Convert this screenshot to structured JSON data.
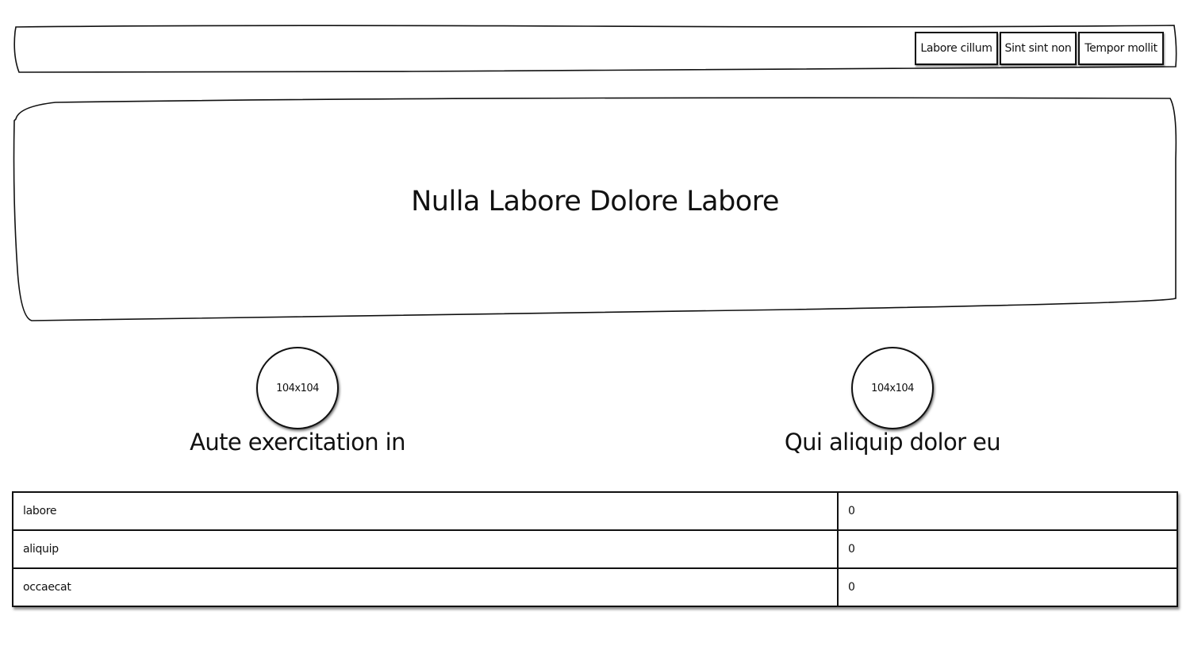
{
  "nav": {
    "links": [
      {
        "label": "Labore cillum"
      },
      {
        "label": "Sint sint non"
      },
      {
        "label": "Tempor mollit"
      }
    ]
  },
  "hero": {
    "title": "Nulla Labore Dolore Labore"
  },
  "features": [
    {
      "image_label": "104x104",
      "title": "Aute exercitation in"
    },
    {
      "image_label": "104x104",
      "title": "Qui aliquip dolor eu"
    }
  ],
  "table": {
    "rows": [
      {
        "name": "labore",
        "value": "0"
      },
      {
        "name": "aliquip",
        "value": "0"
      },
      {
        "name": "occaecat",
        "value": "0"
      }
    ]
  }
}
